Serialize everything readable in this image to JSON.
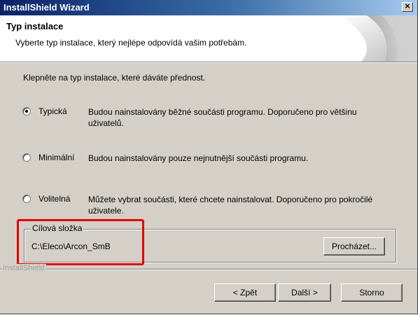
{
  "window": {
    "title": "InstallShield Wizard",
    "close_glyph": "×"
  },
  "header": {
    "title": "Typ instalace",
    "subtitle": "Vyberte typ instalace, který nejlépe odpovídá vašim potřebám."
  },
  "prompt": "Klepněte na typ instalace, které dáváte přednost.",
  "options": [
    {
      "label": "Typická",
      "desc_line1": "Budou nainstalovány běžné součásti programu. Doporučeno pro většinu",
      "desc_line2": "uživatelů.",
      "selected": true
    },
    {
      "label": "Minimální",
      "desc_line1": "Budou nainstalovány pouze nejnutnější součásti programu.",
      "desc_line2": "",
      "selected": false
    },
    {
      "label": "Volitelná",
      "desc_line1": "Můžete vybrat součásti, které chcete nainstalovat. Doporučeno pro pokročilé",
      "desc_line2": "uživatele.",
      "selected": false
    }
  ],
  "destination": {
    "legend": "Cílová složka",
    "path": "C:\\Eleco\\Arcon_SmB",
    "browse_label": "Procházet..."
  },
  "brand": "InstallShield",
  "buttons": {
    "back": "< Zpět",
    "next": "Další >",
    "cancel": "Storno"
  },
  "colors": {
    "title_start": "#0a246a",
    "title_end": "#a6caf0",
    "face": "#d4d0c8",
    "highlight": "#e00000"
  }
}
